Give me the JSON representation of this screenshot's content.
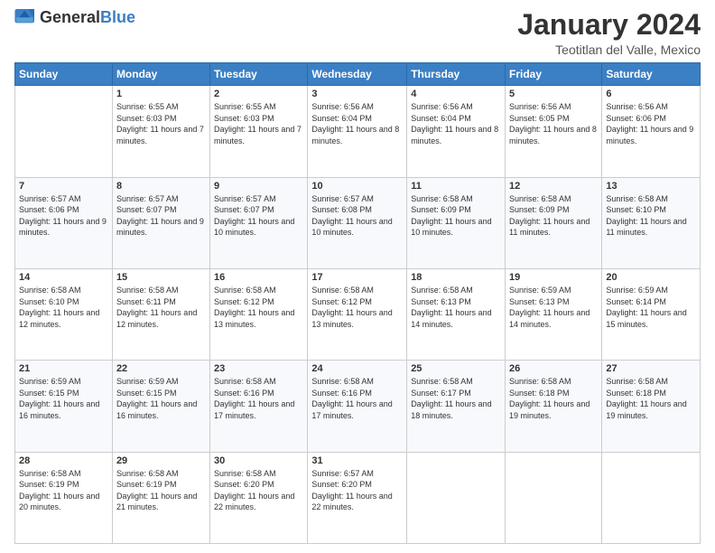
{
  "header": {
    "logo_general": "General",
    "logo_blue": "Blue",
    "title": "January 2024",
    "subtitle": "Teotitlan del Valle, Mexico"
  },
  "days_of_week": [
    "Sunday",
    "Monday",
    "Tuesday",
    "Wednesday",
    "Thursday",
    "Friday",
    "Saturday"
  ],
  "weeks": [
    [
      {
        "day": "",
        "sunrise": "",
        "sunset": "",
        "daylight": ""
      },
      {
        "day": "1",
        "sunrise": "Sunrise: 6:55 AM",
        "sunset": "Sunset: 6:03 PM",
        "daylight": "Daylight: 11 hours and 7 minutes."
      },
      {
        "day": "2",
        "sunrise": "Sunrise: 6:55 AM",
        "sunset": "Sunset: 6:03 PM",
        "daylight": "Daylight: 11 hours and 7 minutes."
      },
      {
        "day": "3",
        "sunrise": "Sunrise: 6:56 AM",
        "sunset": "Sunset: 6:04 PM",
        "daylight": "Daylight: 11 hours and 8 minutes."
      },
      {
        "day": "4",
        "sunrise": "Sunrise: 6:56 AM",
        "sunset": "Sunset: 6:04 PM",
        "daylight": "Daylight: 11 hours and 8 minutes."
      },
      {
        "day": "5",
        "sunrise": "Sunrise: 6:56 AM",
        "sunset": "Sunset: 6:05 PM",
        "daylight": "Daylight: 11 hours and 8 minutes."
      },
      {
        "day": "6",
        "sunrise": "Sunrise: 6:56 AM",
        "sunset": "Sunset: 6:06 PM",
        "daylight": "Daylight: 11 hours and 9 minutes."
      }
    ],
    [
      {
        "day": "7",
        "sunrise": "Sunrise: 6:57 AM",
        "sunset": "Sunset: 6:06 PM",
        "daylight": "Daylight: 11 hours and 9 minutes."
      },
      {
        "day": "8",
        "sunrise": "Sunrise: 6:57 AM",
        "sunset": "Sunset: 6:07 PM",
        "daylight": "Daylight: 11 hours and 9 minutes."
      },
      {
        "day": "9",
        "sunrise": "Sunrise: 6:57 AM",
        "sunset": "Sunset: 6:07 PM",
        "daylight": "Daylight: 11 hours and 10 minutes."
      },
      {
        "day": "10",
        "sunrise": "Sunrise: 6:57 AM",
        "sunset": "Sunset: 6:08 PM",
        "daylight": "Daylight: 11 hours and 10 minutes."
      },
      {
        "day": "11",
        "sunrise": "Sunrise: 6:58 AM",
        "sunset": "Sunset: 6:09 PM",
        "daylight": "Daylight: 11 hours and 10 minutes."
      },
      {
        "day": "12",
        "sunrise": "Sunrise: 6:58 AM",
        "sunset": "Sunset: 6:09 PM",
        "daylight": "Daylight: 11 hours and 11 minutes."
      },
      {
        "day": "13",
        "sunrise": "Sunrise: 6:58 AM",
        "sunset": "Sunset: 6:10 PM",
        "daylight": "Daylight: 11 hours and 11 minutes."
      }
    ],
    [
      {
        "day": "14",
        "sunrise": "Sunrise: 6:58 AM",
        "sunset": "Sunset: 6:10 PM",
        "daylight": "Daylight: 11 hours and 12 minutes."
      },
      {
        "day": "15",
        "sunrise": "Sunrise: 6:58 AM",
        "sunset": "Sunset: 6:11 PM",
        "daylight": "Daylight: 11 hours and 12 minutes."
      },
      {
        "day": "16",
        "sunrise": "Sunrise: 6:58 AM",
        "sunset": "Sunset: 6:12 PM",
        "daylight": "Daylight: 11 hours and 13 minutes."
      },
      {
        "day": "17",
        "sunrise": "Sunrise: 6:58 AM",
        "sunset": "Sunset: 6:12 PM",
        "daylight": "Daylight: 11 hours and 13 minutes."
      },
      {
        "day": "18",
        "sunrise": "Sunrise: 6:58 AM",
        "sunset": "Sunset: 6:13 PM",
        "daylight": "Daylight: 11 hours and 14 minutes."
      },
      {
        "day": "19",
        "sunrise": "Sunrise: 6:59 AM",
        "sunset": "Sunset: 6:13 PM",
        "daylight": "Daylight: 11 hours and 14 minutes."
      },
      {
        "day": "20",
        "sunrise": "Sunrise: 6:59 AM",
        "sunset": "Sunset: 6:14 PM",
        "daylight": "Daylight: 11 hours and 15 minutes."
      }
    ],
    [
      {
        "day": "21",
        "sunrise": "Sunrise: 6:59 AM",
        "sunset": "Sunset: 6:15 PM",
        "daylight": "Daylight: 11 hours and 16 minutes."
      },
      {
        "day": "22",
        "sunrise": "Sunrise: 6:59 AM",
        "sunset": "Sunset: 6:15 PM",
        "daylight": "Daylight: 11 hours and 16 minutes."
      },
      {
        "day": "23",
        "sunrise": "Sunrise: 6:58 AM",
        "sunset": "Sunset: 6:16 PM",
        "daylight": "Daylight: 11 hours and 17 minutes."
      },
      {
        "day": "24",
        "sunrise": "Sunrise: 6:58 AM",
        "sunset": "Sunset: 6:16 PM",
        "daylight": "Daylight: 11 hours and 17 minutes."
      },
      {
        "day": "25",
        "sunrise": "Sunrise: 6:58 AM",
        "sunset": "Sunset: 6:17 PM",
        "daylight": "Daylight: 11 hours and 18 minutes."
      },
      {
        "day": "26",
        "sunrise": "Sunrise: 6:58 AM",
        "sunset": "Sunset: 6:18 PM",
        "daylight": "Daylight: 11 hours and 19 minutes."
      },
      {
        "day": "27",
        "sunrise": "Sunrise: 6:58 AM",
        "sunset": "Sunset: 6:18 PM",
        "daylight": "Daylight: 11 hours and 19 minutes."
      }
    ],
    [
      {
        "day": "28",
        "sunrise": "Sunrise: 6:58 AM",
        "sunset": "Sunset: 6:19 PM",
        "daylight": "Daylight: 11 hours and 20 minutes."
      },
      {
        "day": "29",
        "sunrise": "Sunrise: 6:58 AM",
        "sunset": "Sunset: 6:19 PM",
        "daylight": "Daylight: 11 hours and 21 minutes."
      },
      {
        "day": "30",
        "sunrise": "Sunrise: 6:58 AM",
        "sunset": "Sunset: 6:20 PM",
        "daylight": "Daylight: 11 hours and 22 minutes."
      },
      {
        "day": "31",
        "sunrise": "Sunrise: 6:57 AM",
        "sunset": "Sunset: 6:20 PM",
        "daylight": "Daylight: 11 hours and 22 minutes."
      },
      {
        "day": "",
        "sunrise": "",
        "sunset": "",
        "daylight": ""
      },
      {
        "day": "",
        "sunrise": "",
        "sunset": "",
        "daylight": ""
      },
      {
        "day": "",
        "sunrise": "",
        "sunset": "",
        "daylight": ""
      }
    ]
  ]
}
